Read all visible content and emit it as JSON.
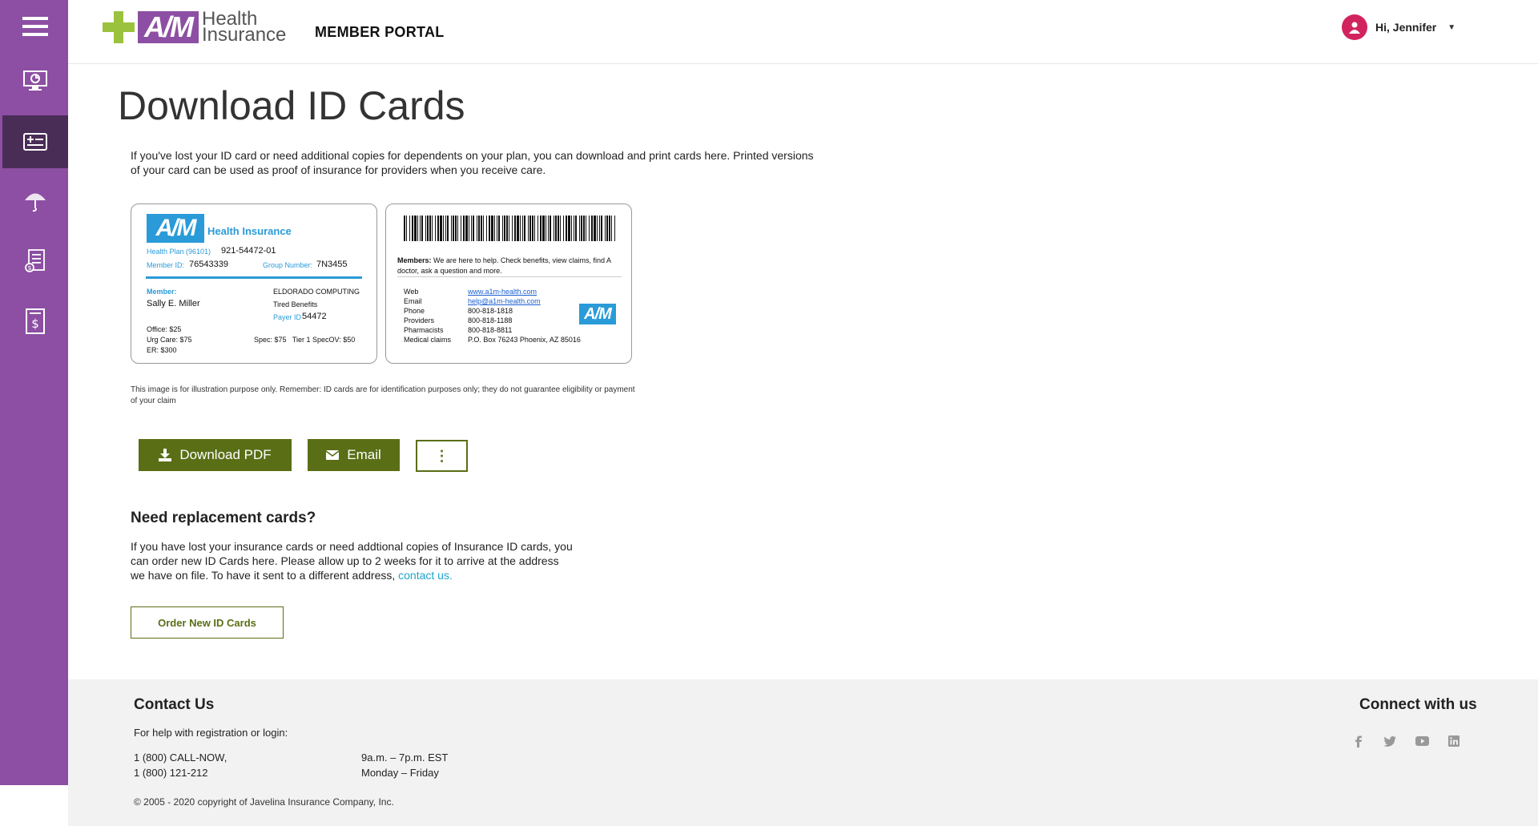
{
  "header": {
    "logo_line1": "Health",
    "logo_line2": "Insurance",
    "logo_mark": "A/M",
    "portal_title": "MEMBER PORTAL",
    "greeting": "Hi, Jennifer",
    "caret": "▼"
  },
  "sidebar": {
    "items": [
      {
        "icon": "menu-icon"
      },
      {
        "icon": "dashboard-monitor-icon"
      },
      {
        "icon": "id-card-icon",
        "active": true
      },
      {
        "icon": "umbrella-icon"
      },
      {
        "icon": "claims-document-icon"
      },
      {
        "icon": "billing-icon"
      }
    ]
  },
  "main": {
    "title": "Download ID Cards",
    "intro": "If you've lost your ID card or need additional copies for dependents on your plan, you can download and print cards here. Printed versions of your card can be used as proof of insurance for providers when you receive care.",
    "disclaimer": "This image is for illustration purpose only. Remember: ID cards are for identification purposes only; they do not guarantee eligibility or payment of your claim",
    "download_pdf_label": "Download PDF",
    "email_label": "Email",
    "more_label": "⋮",
    "replace_heading": "Need replacement cards?",
    "replace_text": "If you have lost your insurance cards or need addtional copies of Insurance ID cards, you can order new ID Cards here. Please allow up to 2 weeks for it to arrive at the address we have on file. To have it sent to a different address,",
    "contact_link": "contact us.",
    "order_label": "Order New ID Cards"
  },
  "card_front": {
    "logo": "A/M",
    "brand": "Health Insurance",
    "health_plan_label": "Health Plan (96101)",
    "health_plan_value": "921-54472-01",
    "member_id_label": "Member ID:",
    "member_id_value": "76543339",
    "group_label": "Group Number:",
    "group_value": "7N3455",
    "member_label": "Member:",
    "member_name": "Sally E. Miller",
    "employer": "ELDORADO COMPUTING",
    "benefits": "Tired Benefits",
    "payer_label": "Payer ID",
    "payer_value": "54472",
    "office": "Office: $25",
    "urg_care": "Urg Care: $75",
    "er": "ER: $300",
    "spec": "Spec: $75   Tier 1 SpecOV: $50"
  },
  "card_back": {
    "members_bold": "Members:",
    "members_text": "We are here to help. Check benefits, view claims, find A doctor, ask a question and more.",
    "rows": [
      {
        "label": "Web",
        "value": "www.a1m-health.com",
        "link": true
      },
      {
        "label": "Email",
        "value": "help@a1m-health.com",
        "link": true
      },
      {
        "label": "Phone",
        "value": "800-818-1818",
        "link": false
      },
      {
        "label": "Providers",
        "value": "800-818-1188",
        "link": false
      },
      {
        "label": "Pharmacists",
        "value": "800-818-8811",
        "link": false
      },
      {
        "label": "Medical claims",
        "value": "P.O. Box 76243 Phoenix, AZ 85016",
        "link": false
      }
    ],
    "logo": "A/M"
  },
  "footer": {
    "contact_title": "Contact Us",
    "help_text": "For help with registration or login:",
    "phone1": "1 (800) CALL-NOW,",
    "phone2": "1 (800) 121-212",
    "hours1": "9a.m. – 7p.m. EST",
    "hours2": "Monday – Friday",
    "copyright": "© 2005 - 2020 copyright of Javelina Insurance Company, Inc.",
    "connect_title": "Connect with us",
    "social": [
      "facebook-icon",
      "twitter-icon",
      "youtube-icon",
      "linkedin-icon"
    ]
  },
  "colors": {
    "sidebar": "#8c4fa3",
    "sidebar_active": "#4a2d57",
    "primary_button": "#5a6e16",
    "card_blue": "#2a9bd8",
    "avatar": "#d1245f",
    "link": "#1fa3c9"
  }
}
